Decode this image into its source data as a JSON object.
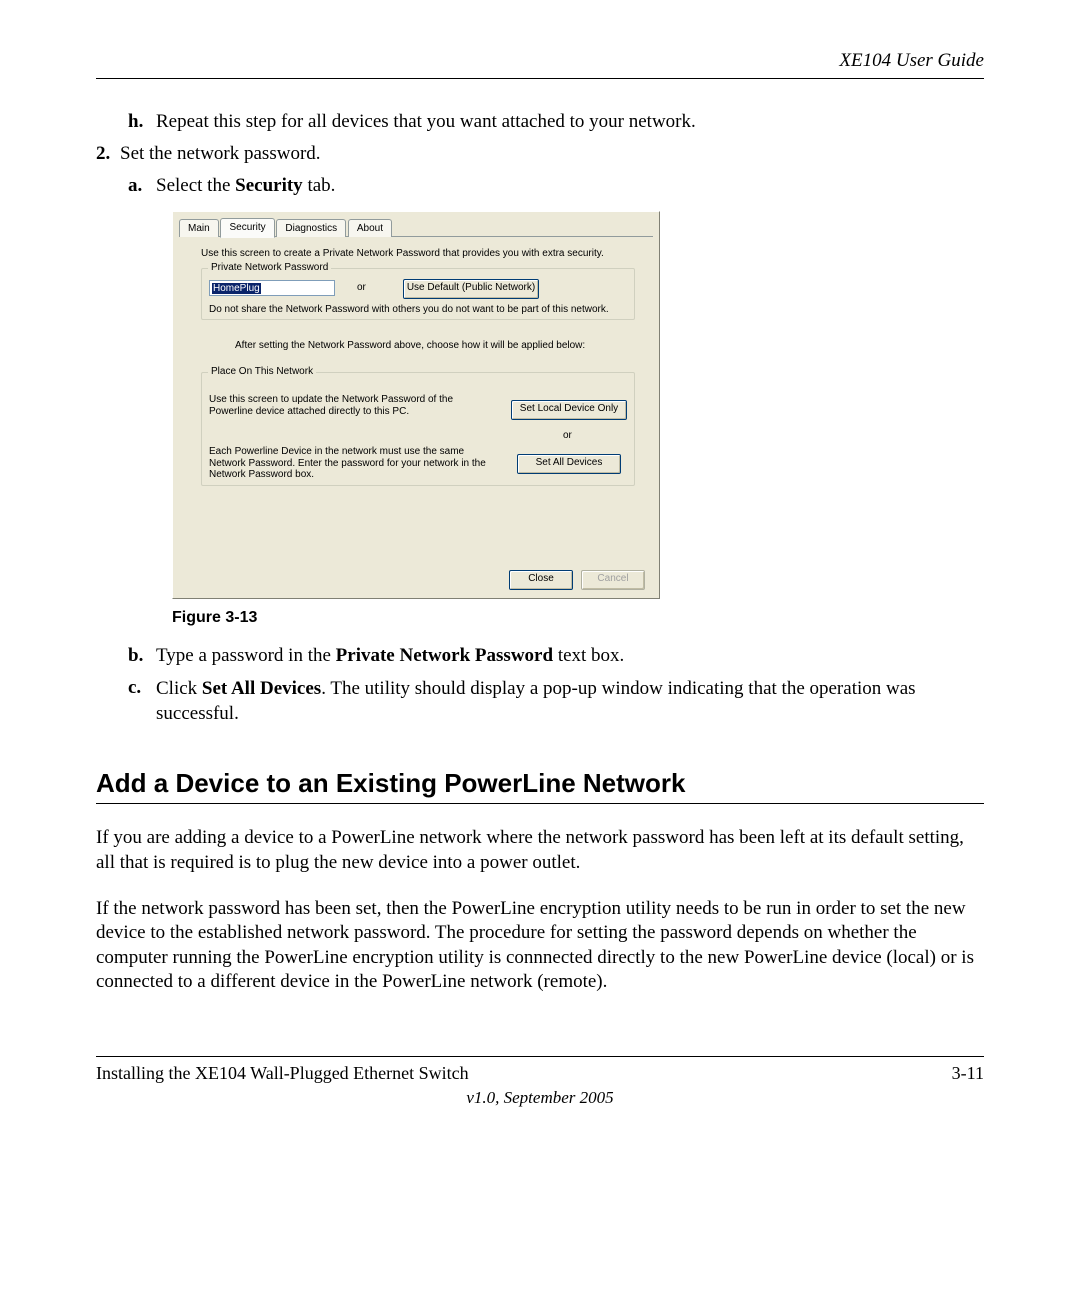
{
  "header": {
    "title": "XE104 User Guide"
  },
  "list": {
    "h_marker": "h.",
    "h_text": "Repeat this step for all devices that you want attached to your network.",
    "two_marker": "2.",
    "two_text": "Set the network password.",
    "a_marker": "a.",
    "a_prefix": "Select the ",
    "a_bold": "Security",
    "a_suffix": " tab.",
    "b_marker": "b.",
    "b_prefix": "Type a password in the ",
    "b_bold": "Private Network Password",
    "b_suffix": " text box.",
    "c_marker": "c.",
    "c_prefix": "Click ",
    "c_bold": "Set All Devices",
    "c_suffix": ". The utility should display a pop-up window indicating that the operation was successful."
  },
  "figure": {
    "caption": "Figure 3-13",
    "tabs": {
      "main": "Main",
      "security": "Security",
      "diagnostics": "Diagnostics",
      "about": "About"
    },
    "intro": "Use this screen to create a Private Network Password that provides you with extra security.",
    "group1": {
      "title": "Private Network Password",
      "input_value": "HomePlug",
      "or": "or",
      "default_btn": "Use Default (Public Network)",
      "warn": "Do not share the Network Password with others you do not want to be part of this network."
    },
    "middle": "After setting the Network Password above, choose how it will be applied below:",
    "group2": {
      "title": "Place On This Network",
      "text1": "Use this screen to update the Network Password of the Powerline device attached directly to this PC.",
      "btn1": "Set Local Device Only",
      "or": "or",
      "text2": "Each Powerline Device in the network must use the same Network Password. Enter the password for your network in the Network Password box.",
      "btn2": "Set All Devices"
    },
    "close_btn": "Close",
    "cancel_btn": "Cancel"
  },
  "section": {
    "heading": "Add a Device to an Existing PowerLine Network"
  },
  "para1": "If you are adding a device to a PowerLine network where the network password has been left at its default setting, all that is required is to plug the new device into a power outlet.",
  "para2": "If the network password has been set, then the PowerLine encryption utility needs to be run in order to set the new device to the established network password. The procedure for setting the password depends on whether the computer running the PowerLine encryption utility is connnected directly to the new PowerLine device (local) or is connected to a different device in the PowerLine network (remote).",
  "footer": {
    "left": "Installing the XE104 Wall-Plugged Ethernet Switch",
    "right": "3-11",
    "center": "v1.0, September 2005"
  }
}
